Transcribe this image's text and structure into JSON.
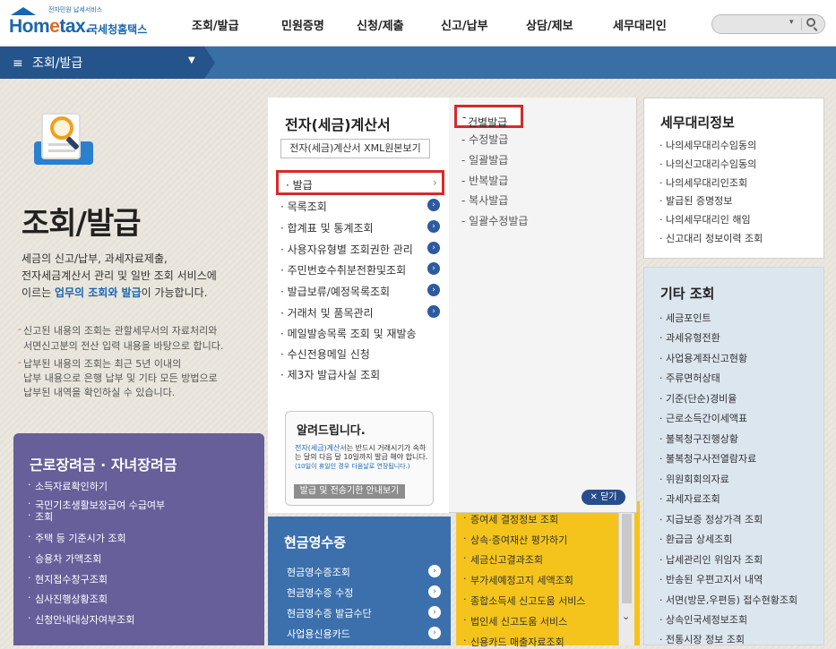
{
  "logo": {
    "small": "전자민원 납세서비스",
    "word_a": "Hom",
    "word_e": "e",
    "word_b": "tax.",
    "kr": "국세청홈택스"
  },
  "gnb": [
    "조회/발급",
    "민원증명",
    "신청/제출",
    "신고/납부",
    "상담/제보",
    "세무대리인"
  ],
  "search": {
    "dropdown": "▾"
  },
  "subbar": {
    "label": "조회/발급"
  },
  "left": {
    "title": "조회/발급",
    "intro_lines": [
      "세금의 신고/납부, 과세자료제출,",
      "전자세금계산서 관리 및 일반 조회 서비스에"
    ],
    "intro_last_pre": "이르는 ",
    "intro_last_hl": "업무의 조회와 발급",
    "intro_last_post": "이 가능합니다.",
    "notes": [
      "신고된 내용의 조회는 관할세무서의 자료처리와",
      "서면신고분의 전산 입력 내용을 바탕으로 합니다.",
      "납부된 내용의 조회는 최근 5년 이내의",
      "납부 내용으로 은행 납부 및 기타 모든 방법으로",
      "납부된 내역을 확인하실 수 있습니다."
    ],
    "note_prefix_1": "- ",
    "note_prefix_2": "- "
  },
  "labor": {
    "title": "근로장려금 · 자녀장려금",
    "items": [
      "소득자료확인하기",
      "국민기초생활보장급여 수급여부",
      "조회",
      "주택 등 기준시가 조회",
      "승용차 가액조회",
      "현지접수창구조회",
      "심사진행상황조회",
      "신청안내대상자여부조회"
    ]
  },
  "einvoice": {
    "title": "전자(세금)계산서",
    "xml_button": "전자(세금)계산서 XML원본보기",
    "active": "발급",
    "items": [
      "목록조회",
      "합계표 및 통계조회",
      "사용자유형별 조회권한 관리",
      "주민번호수취분전환및조회",
      "발급보류/예정목록조회",
      "거래처 및 품목관리",
      "메일발송목록 조회 및 재발송",
      "수신전용메일 신청",
      "제3자 발급사실 조회"
    ],
    "sub_items": [
      "건별발급",
      "수정발급",
      "일괄발급",
      "반복발급",
      "복사발급",
      "일괄수정발급"
    ],
    "notice_title": "알려드립니다.",
    "notice_hl": "전자(세금)계산서",
    "notice_body": "는 반드시 거래시기가 속하는 달의 다음 달 10일까지 발급 해야 합니다.",
    "notice_small": "(10일이 휴일인 경우 다음날로 연장됩니다.)",
    "notice_button": "발급 및 전송기한 안내보기",
    "close_button": "✕ 닫기"
  },
  "tax_agent": {
    "title": "세무대리정보",
    "items": [
      "나의세무대리수임동의",
      "나의신고대리수임동의",
      "나의세무대리인조회",
      "발급된 증명정보",
      "나의세무대리인 해임",
      "신고대리 정보이력 조회"
    ]
  },
  "other": {
    "title": "기타 조회",
    "items": [
      "세금포인트",
      "과세유형전환",
      "사업용계좌신고현황",
      "주류면허상태",
      "기준(단순)경비율",
      "근로소득간이세액표",
      "불복청구진행상황",
      "불복청구사전열람자료",
      "위원회회의자료",
      "과세자료조회",
      "지급보증 정상가격 조회",
      "환급금 상세조회",
      "납세관리인 위임자 조회",
      "반송된 우편고지서 내역",
      "서면(방문,우편등) 접수현황조회",
      "상속인국세정보조회",
      "전통시장 정보 조회"
    ]
  },
  "cash": {
    "title": "현금영수증",
    "items": [
      "현금영수증조회",
      "현금영수증 수정",
      "현금영수증 발급수단",
      "사업용신용카드"
    ]
  },
  "yellow": {
    "items": [
      "증여세 결정정보 조회",
      "상속·증여재산 평가하기",
      "세금신고결과조회",
      "부가세예정고지 세액조회",
      "종합소득세 신고도움 서비스",
      "법인세 신고도움 서비스",
      "신용카드 매출자료조회"
    ]
  }
}
